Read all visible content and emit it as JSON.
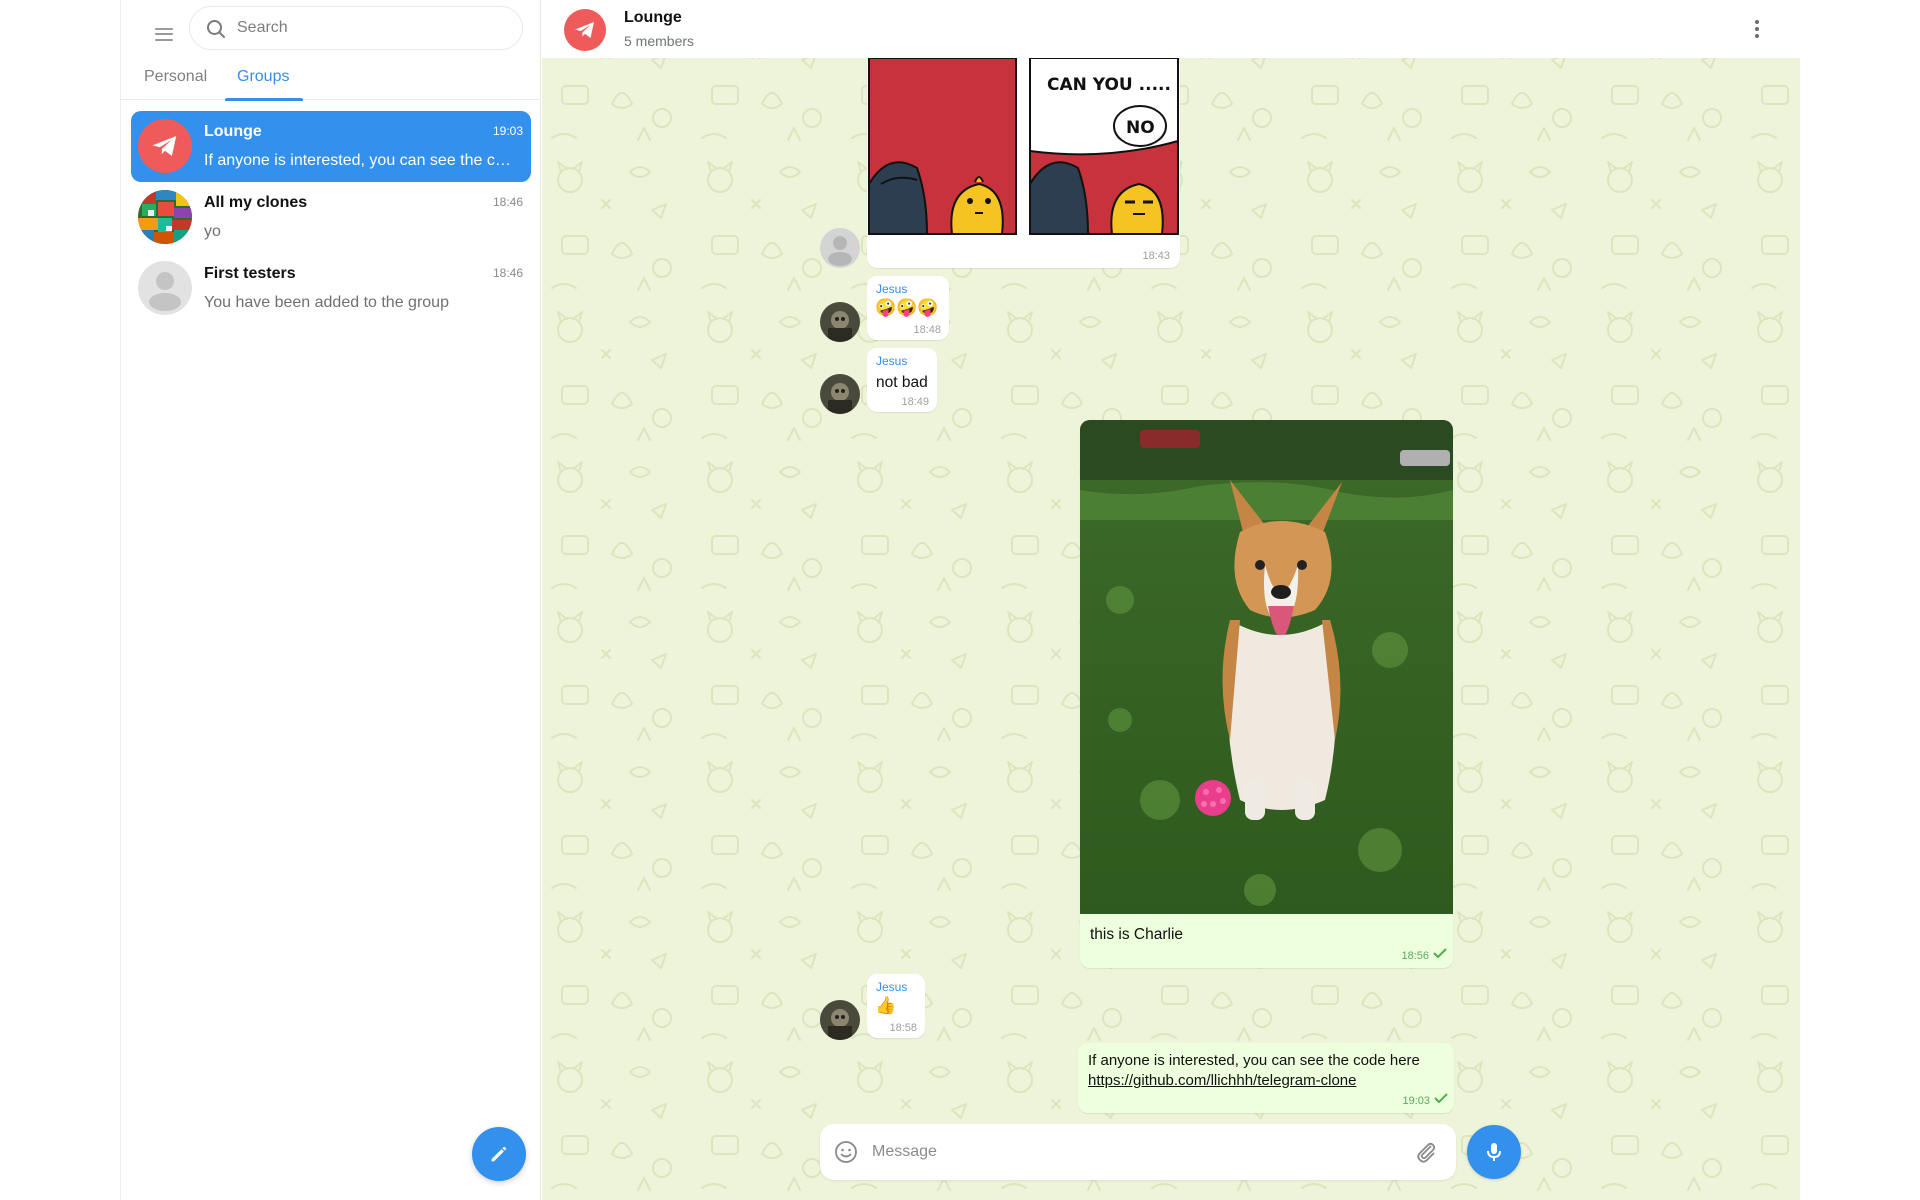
{
  "sidebar": {
    "search_placeholder": "Search",
    "tabs": [
      {
        "label": "Personal",
        "active": false
      },
      {
        "label": "Groups",
        "active": true
      }
    ],
    "chats": [
      {
        "title": "Lounge",
        "time": "19:03",
        "preview": "If anyone is interested, you can see the code here https://github.com/llichhh/telegram-clone",
        "active": true,
        "avatar": "telegram-logo"
      },
      {
        "title": "All my clones",
        "time": "18:46",
        "preview": "yo",
        "active": false,
        "avatar": "colorful-image"
      },
      {
        "title": "First testers",
        "time": "18:46",
        "preview": "You have been added to the group",
        "active": false,
        "avatar": "default-person"
      }
    ]
  },
  "chat": {
    "title": "Lounge",
    "subtitle": "5 members",
    "messages": [
      {
        "type": "image",
        "content": "comic-strip",
        "comic_text_1": "CAN YOU .....",
        "comic_text_2": "NO",
        "time": "18:43",
        "direction": "in"
      },
      {
        "type": "text",
        "sender": "Jesus",
        "text": "🤪🤪🤪",
        "time": "18:48",
        "direction": "in"
      },
      {
        "type": "text",
        "sender": "Jesus",
        "text": "not bad",
        "time": "18:49",
        "direction": "in"
      },
      {
        "type": "photo",
        "caption": "this is Charlie",
        "time": "18:56",
        "direction": "out"
      },
      {
        "type": "text",
        "sender": "Jesus",
        "text": "👍",
        "time": "18:58",
        "direction": "in"
      },
      {
        "type": "text",
        "text": "If anyone is interested, you can see the code here",
        "link": "https://github.com/llichhh/telegram-clone",
        "time": "19:03",
        "direction": "out"
      }
    ],
    "composer_placeholder": "Message"
  },
  "colors": {
    "accent": "#3390ec",
    "chat_background": "#eef4d9",
    "outgoing_bubble": "#eeffde",
    "lounge_avatar": "#ef5b5b"
  },
  "icons": [
    "menu-icon",
    "search-icon",
    "compose-icon",
    "more-icon",
    "emoji-icon",
    "attach-icon",
    "mic-icon"
  ]
}
